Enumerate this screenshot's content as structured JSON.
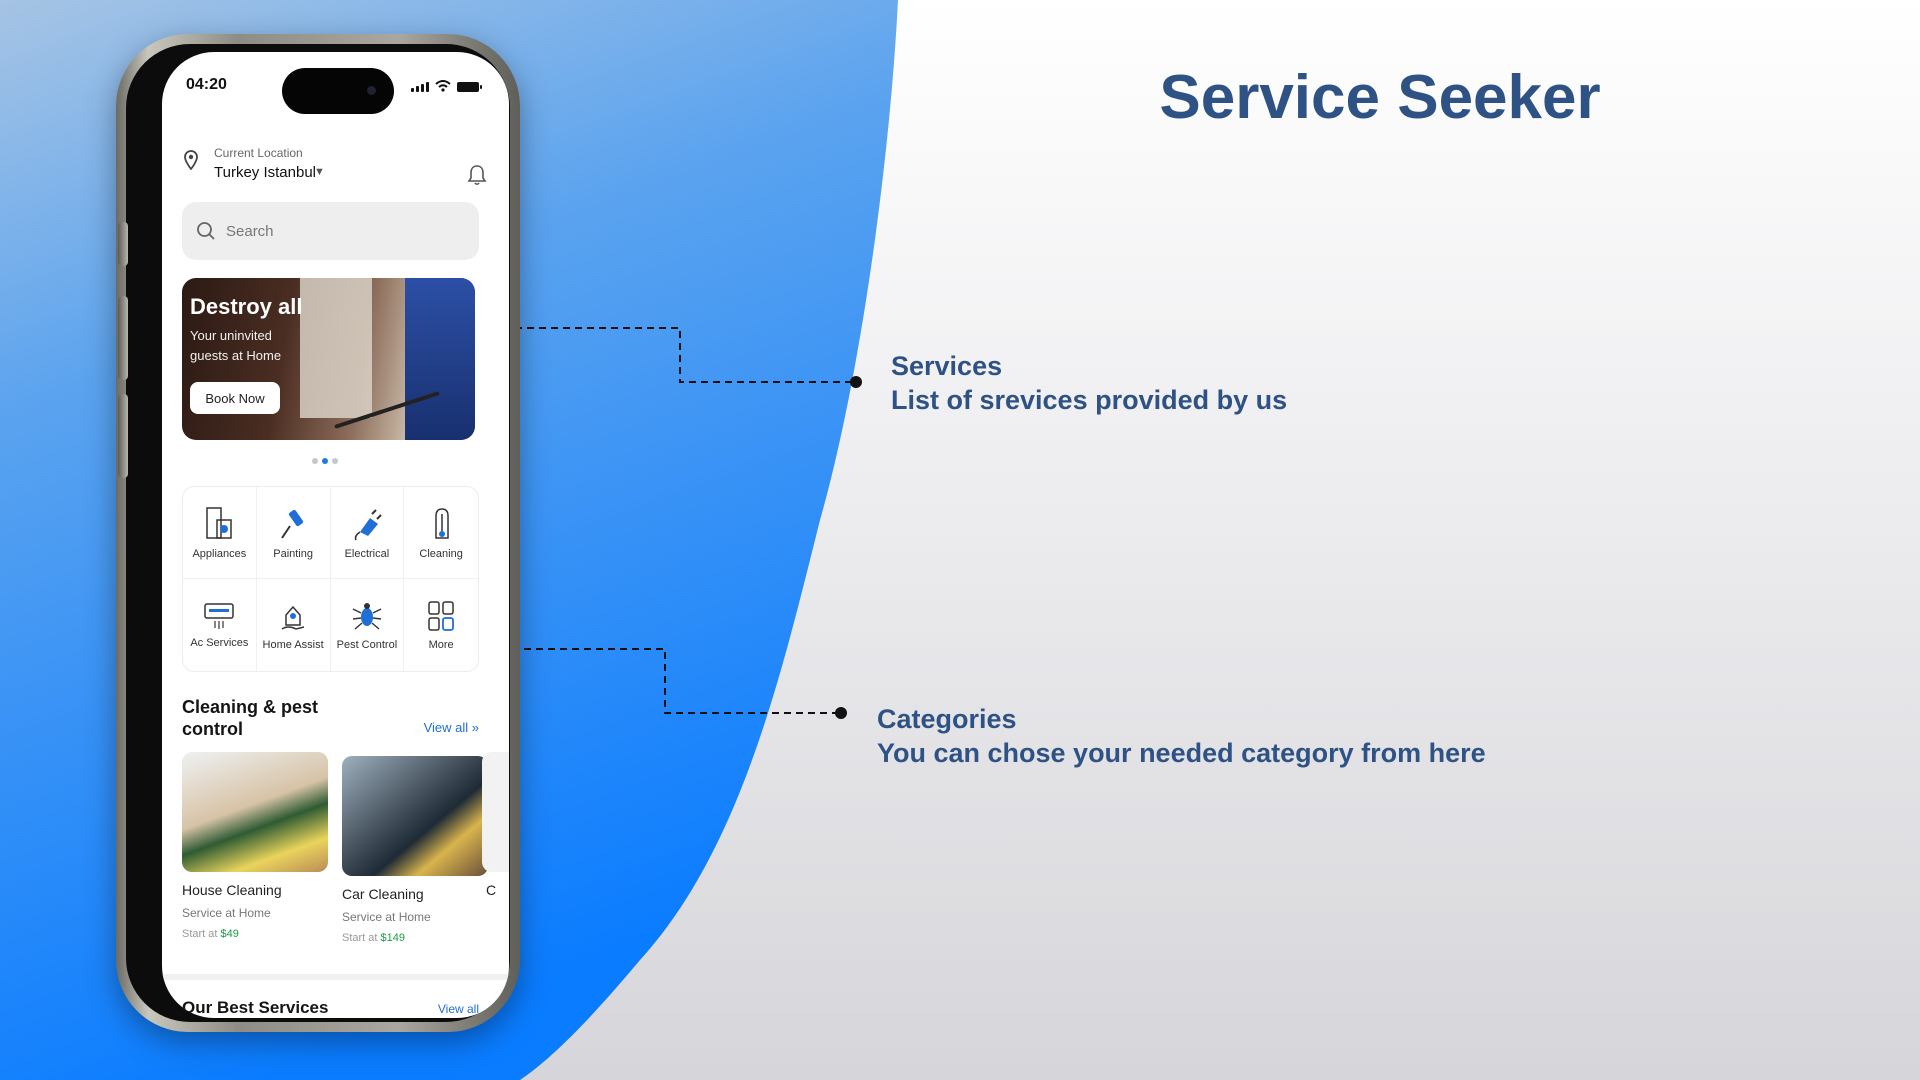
{
  "slide": {
    "title": "Service Seeker",
    "annotations": {
      "services_heading": "Services",
      "services_text": "List of srevices provided by us",
      "categories_heading": "Categories",
      "categories_text": "You can chose your needed category from here"
    },
    "colors": {
      "title": "#2f5285",
      "accent_blue": "#0a7cff"
    }
  },
  "app": {
    "status_bar": {
      "time": "04:20"
    },
    "location": {
      "label": "Current Location",
      "value": "Turkey Istanbul"
    },
    "search": {
      "placeholder": "Search"
    },
    "banner": {
      "title": "Destroy all",
      "subtitle": "Your uninvited guests at Home",
      "button": "Book Now",
      "pager": {
        "count": 3,
        "active": 2
      }
    },
    "categories": [
      {
        "label": "Appliances",
        "icon": "appliances-icon"
      },
      {
        "label": "Painting",
        "icon": "paint-roller-icon"
      },
      {
        "label": "Electrical",
        "icon": "plug-icon"
      },
      {
        "label": "Cleaning",
        "icon": "vacuum-icon"
      },
      {
        "label": "Ac Services",
        "icon": "air-conditioner-icon"
      },
      {
        "label": "Home Assist",
        "icon": "home-hand-icon"
      },
      {
        "label": "Pest Control",
        "icon": "bug-icon"
      },
      {
        "label": "More",
        "icon": "grid-icon"
      }
    ],
    "section": {
      "title": "Cleaning & pest control",
      "view_all": "View all"
    },
    "services": [
      {
        "name": "House Cleaning",
        "sub": "Service at Home",
        "price_prefix": "Start at",
        "price": "$49"
      },
      {
        "name": "Car Cleaning",
        "sub": "Service at Home",
        "price_prefix": "Start at",
        "price": "$149"
      }
    ],
    "peek_card_initial": "C",
    "next_section": {
      "title": "Our Best Services",
      "view_all": "View all"
    }
  }
}
